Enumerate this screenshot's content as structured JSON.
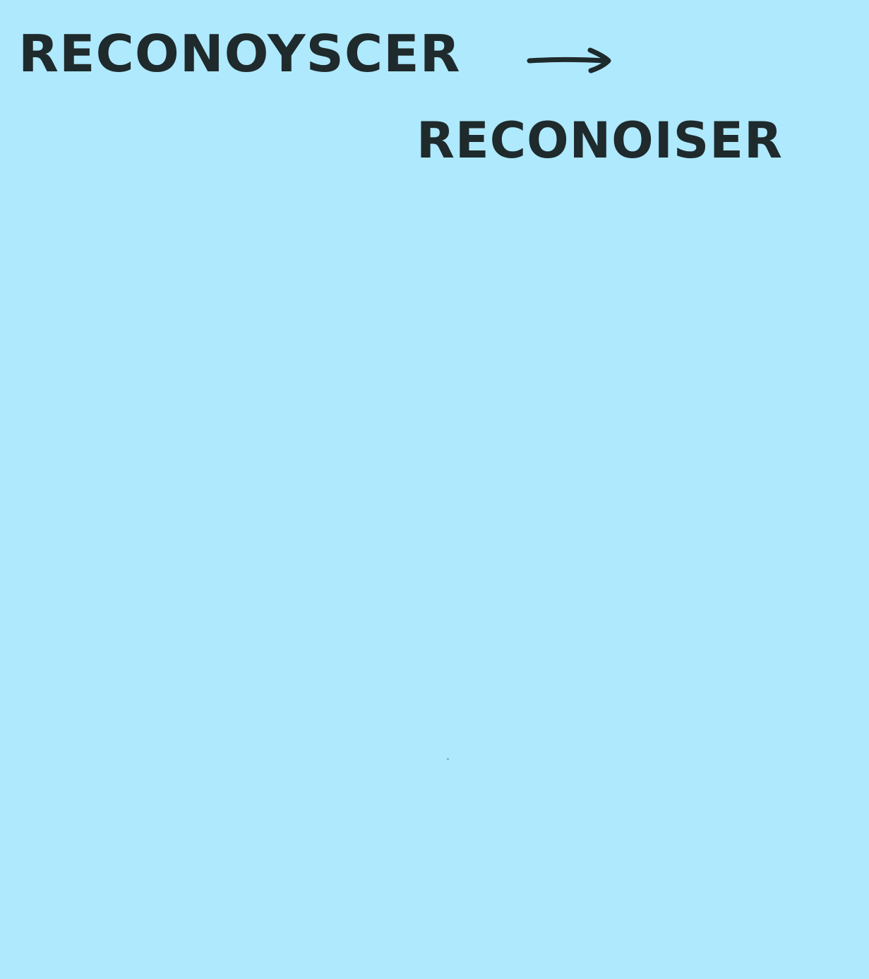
{
  "note": {
    "background_color": "#aee9fd",
    "ink_color": "#1f2a2c",
    "original_word": "RECONOYSCER",
    "modern_word": "RECONOISER",
    "connector_icon": "arrow-right-icon"
  }
}
